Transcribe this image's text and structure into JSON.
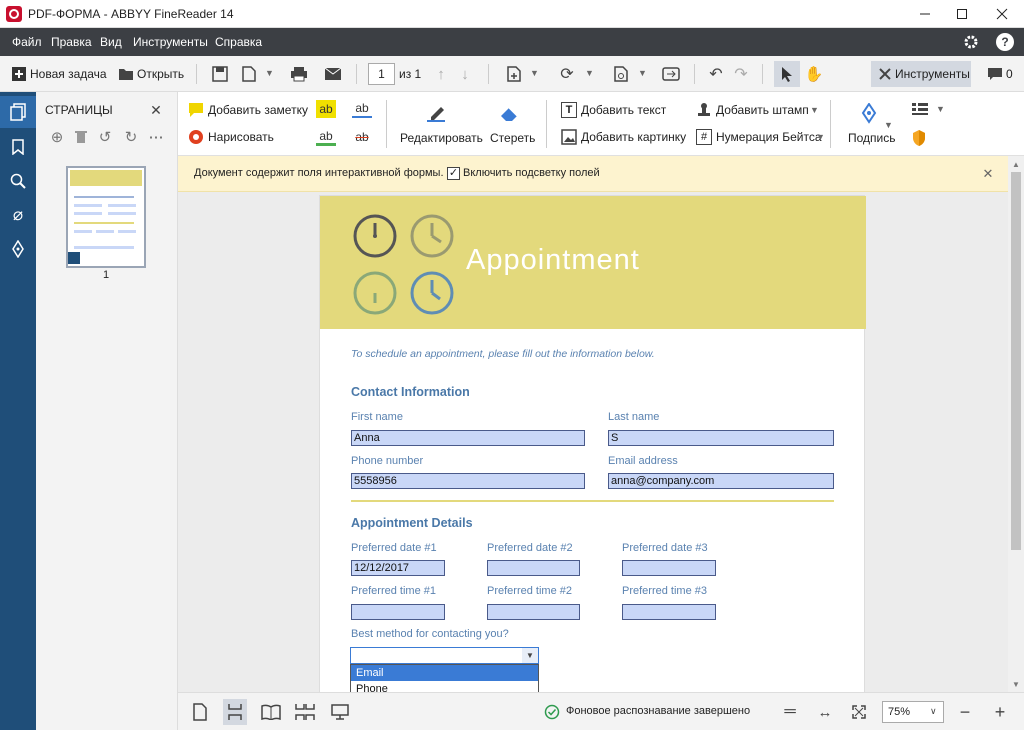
{
  "window": {
    "title": "PDF-ФОРМА - ABBYY FineReader 14"
  },
  "menu": [
    "Файл",
    "Правка",
    "Вид",
    "Инструменты",
    "Справка"
  ],
  "toolbar": {
    "new_task": "Новая задача",
    "open": "Открыть",
    "page_number": "1",
    "page_of": "из 1",
    "tools": "Инструменты",
    "comments_count": "0"
  },
  "pages_panel": {
    "title": "СТРАНИЦЫ",
    "thumb_label": "1"
  },
  "ribbon": {
    "add_note": "Добавить заметку",
    "draw": "Нарисовать",
    "edit": "Редактировать",
    "erase": "Стереть",
    "add_text": "Добавить текст",
    "add_picture": "Добавить картинку",
    "add_stamp": "Добавить штамп",
    "bates": "Нумерация Бейтса",
    "sign": "Подпись",
    "ab": "ab"
  },
  "infobar": {
    "message": "Документ содержит поля интерактивной формы.",
    "highlight_label": "Включить подсветку полей",
    "highlight_checked": true
  },
  "form": {
    "title": "Appointment",
    "intro": "To schedule an appointment, please fill out the information below.",
    "contact_heading": "Contact Information",
    "first_name_label": "First name",
    "first_name": "Anna",
    "last_name_label": "Last name",
    "last_name": "S",
    "phone_label": "Phone number",
    "phone": "5558956",
    "email_label": "Email address",
    "email": "anna@company.com",
    "details_heading": "Appointment Details",
    "date1_label": "Preferred date #1",
    "date1": "12/12/2017",
    "date2_label": "Preferred date #2",
    "date2": "",
    "date3_label": "Preferred date #3",
    "date3": "",
    "time1_label": "Preferred time #1",
    "time2_label": "Preferred time #2",
    "time3_label": "Preferred time #3",
    "contact_method_label": "Best method for contacting you?",
    "contact_options": [
      "Email",
      "Phone"
    ],
    "selected_option": "Email"
  },
  "status": {
    "message": "Фоновое распознавание завершено",
    "zoom": "75%"
  },
  "colors": {
    "header_band": "#e3d97c",
    "accent_blue": "#1f4e79",
    "field_fill": "#c9d7f7",
    "dropdown_highlight": "#3a7bd5"
  }
}
